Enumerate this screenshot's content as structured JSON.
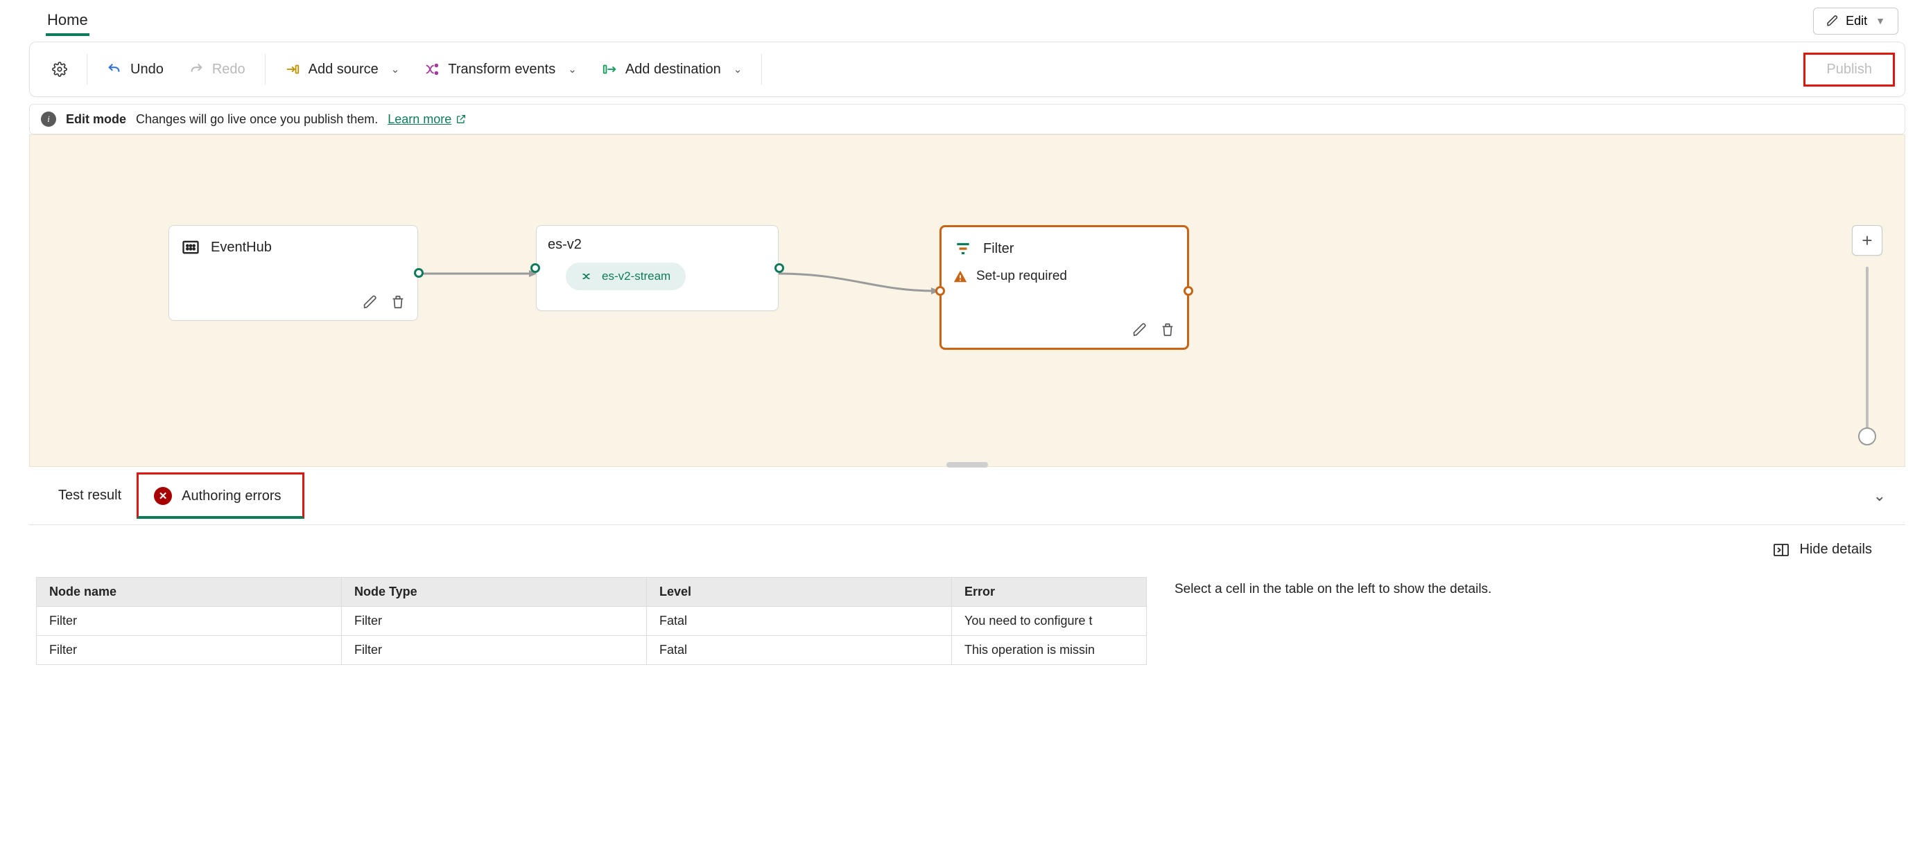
{
  "header": {
    "tab_label": "Home",
    "edit_label": "Edit"
  },
  "toolbar": {
    "undo_label": "Undo",
    "redo_label": "Redo",
    "add_source_label": "Add source",
    "transform_label": "Transform events",
    "add_destination_label": "Add destination",
    "publish_label": "Publish"
  },
  "info": {
    "title": "Edit mode",
    "message": "Changes will go live once you publish them.",
    "link_label": "Learn more"
  },
  "nodes": {
    "eventhub": {
      "title": "EventHub"
    },
    "esv2": {
      "title": "es-v2",
      "chip_label": "es-v2-stream"
    },
    "filter": {
      "title": "Filter",
      "status": "Set-up required"
    }
  },
  "panel": {
    "tabs": {
      "test_result": "Test result",
      "authoring_errors": "Authoring errors"
    },
    "hide_details_label": "Hide details",
    "side_message": "Select a cell in the table on the left to show the details.",
    "columns": [
      "Node name",
      "Node Type",
      "Level",
      "Error"
    ],
    "rows": [
      {
        "node_name": "Filter",
        "node_type": "Filter",
        "level": "Fatal",
        "error": "You need to configure t"
      },
      {
        "node_name": "Filter",
        "node_type": "Filter",
        "level": "Fatal",
        "error": "This operation is missin"
      }
    ]
  }
}
